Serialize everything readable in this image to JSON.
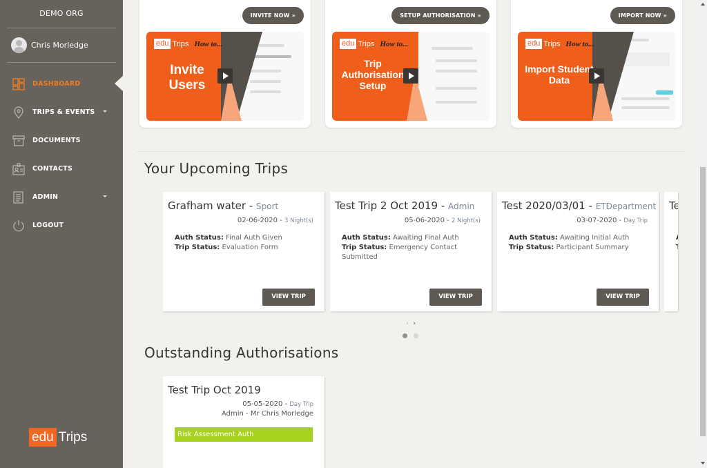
{
  "sidebar": {
    "org": "DEMO ORG",
    "user_name": "Chris Morledge",
    "items": [
      {
        "label": "DASHBOARD",
        "icon": "dashboard-icon",
        "active": true,
        "has_dropdown": false
      },
      {
        "label": "TRIPS & EVENTS",
        "icon": "map-pin-icon",
        "active": false,
        "has_dropdown": true
      },
      {
        "label": "DOCUMENTS",
        "icon": "archive-box-icon",
        "active": false,
        "has_dropdown": false
      },
      {
        "label": "CONTACTS",
        "icon": "id-card-icon",
        "active": false,
        "has_dropdown": false
      },
      {
        "label": "ADMIN",
        "icon": "document-icon",
        "active": false,
        "has_dropdown": true
      },
      {
        "label": "LOGOUT",
        "icon": "power-icon",
        "active": false,
        "has_dropdown": false
      }
    ],
    "logo": {
      "edu": "edu",
      "trips": "Trips"
    }
  },
  "howto": {
    "brand_edu": "edu",
    "brand_trips": "Trips",
    "brand_howto": "How to...",
    "cards": [
      {
        "button": "INVITE NOW »",
        "video_title_1": "Invite",
        "video_title_2": "Users",
        "video_title_3": ""
      },
      {
        "button": "SETUP AUTHORISATION »",
        "video_title_1": "Trip",
        "video_title_2": "Authorisation",
        "video_title_3": "Setup"
      },
      {
        "button": "IMPORT NOW »",
        "video_title_1": "Import Student",
        "video_title_2": "Data",
        "video_title_3": ""
      }
    ]
  },
  "upcoming": {
    "title": "Your Upcoming Trips",
    "auth_label": "Auth Status:",
    "trip_label": "Trip Status:",
    "view_button": "VIEW TRIP",
    "trips": [
      {
        "name": "Grafham water",
        "dept": "Sport",
        "date": "02-06-2020",
        "duration": "3 Night(s)",
        "auth_status": "Final Auth Given",
        "trip_status": "Evaluation Form"
      },
      {
        "name": "Test Trip 2 Oct 2019",
        "dept": "Admin",
        "date": "05-06-2020",
        "duration": "2 Night(s)",
        "auth_status": "Awaiting Final Auth",
        "trip_status": "Emergency Contact Submitted"
      },
      {
        "name": "Test 2020/03/01",
        "dept": "ETDepartment",
        "date": "03-07-2020",
        "duration": "Day Trip",
        "auth_status": "Awaiting Initial Auth",
        "trip_status": "Participant Summary"
      },
      {
        "name": "Te",
        "partial": true
      }
    ],
    "carousel": {
      "prev": "‹",
      "next": "›",
      "pages": 2,
      "current_page": 1
    }
  },
  "outstanding": {
    "title": "Outstanding Authorisations",
    "items": [
      {
        "name": "Test Trip Oct 2019",
        "date": "05-05-2020",
        "duration": "Day Trip",
        "who": "Admin - Mr Chris Morledge",
        "badge": "Risk Assessment Auth",
        "badge_color": "#a8d11f"
      }
    ]
  },
  "colors": {
    "accent": "#ee7d22",
    "sidebar": "#67625c",
    "button": "#5e5953",
    "brand_orange": "#f26722"
  }
}
